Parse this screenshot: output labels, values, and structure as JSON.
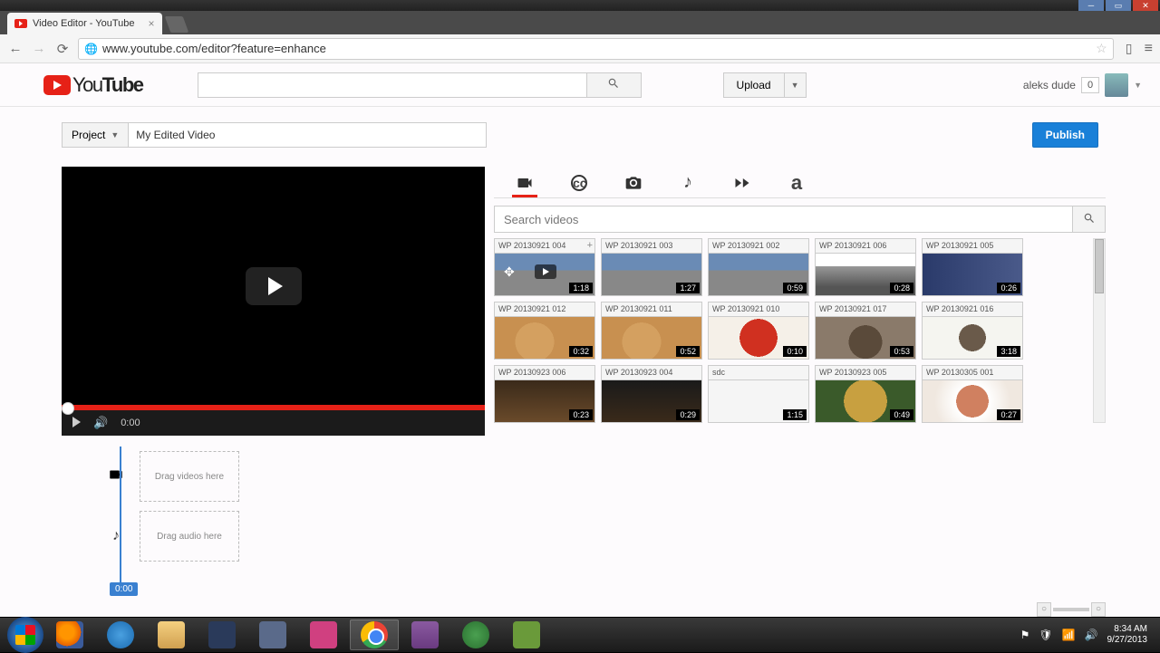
{
  "window": {
    "title": "Video Editor - YouTube"
  },
  "browser": {
    "url": "www.youtube.com/editor?feature=enhance"
  },
  "header": {
    "logo_text": "YouTube",
    "search_placeholder": "",
    "upload_label": "Upload",
    "username": "aleks dude",
    "notif_count": "0"
  },
  "editor": {
    "project_label": "Project",
    "project_name": "My Edited Video",
    "publish_label": "Publish",
    "search_placeholder": "Search videos",
    "preview_time": "0:00",
    "timeline": {
      "video_hint": "Drag videos here",
      "audio_hint": "Drag audio here",
      "playhead_time": "0:00"
    }
  },
  "clips": [
    {
      "title": "WP 20130921 004",
      "dur": "1:18",
      "thumb": "th-crowd",
      "first": true
    },
    {
      "title": "WP 20130921 003",
      "dur": "1:27",
      "thumb": "th-crowd"
    },
    {
      "title": "WP 20130921 002",
      "dur": "0:59",
      "thumb": "th-crowd"
    },
    {
      "title": "WP 20130921 006",
      "dur": "0:28",
      "thumb": "th-truck"
    },
    {
      "title": "WP 20130921 005",
      "dur": "0:26",
      "thumb": "th-store"
    },
    {
      "title": "WP 20130921 012",
      "dur": "0:32",
      "thumb": "th-food1"
    },
    {
      "title": "WP 20130921 011",
      "dur": "0:52",
      "thumb": "th-food1"
    },
    {
      "title": "WP 20130921 010",
      "dur": "0:10",
      "thumb": "th-cup"
    },
    {
      "title": "WP 20130921 017",
      "dur": "0:53",
      "thumb": "th-cat"
    },
    {
      "title": "WP 20130921 016",
      "dur": "3:18",
      "thumb": "th-cat2"
    },
    {
      "title": "WP 20130923 006",
      "dur": "0:23",
      "thumb": "th-food2"
    },
    {
      "title": "WP 20130923 004",
      "dur": "0:29",
      "thumb": "th-dark"
    },
    {
      "title": "sdc",
      "dur": "1:15",
      "thumb": "th-white"
    },
    {
      "title": "WP 20130923 005",
      "dur": "0:49",
      "thumb": "th-noodle"
    },
    {
      "title": "WP 20130305 001",
      "dur": "0:27",
      "thumb": "th-plate"
    }
  ],
  "taskbar": {
    "time": "8:34 AM",
    "date": "9/27/2013"
  }
}
